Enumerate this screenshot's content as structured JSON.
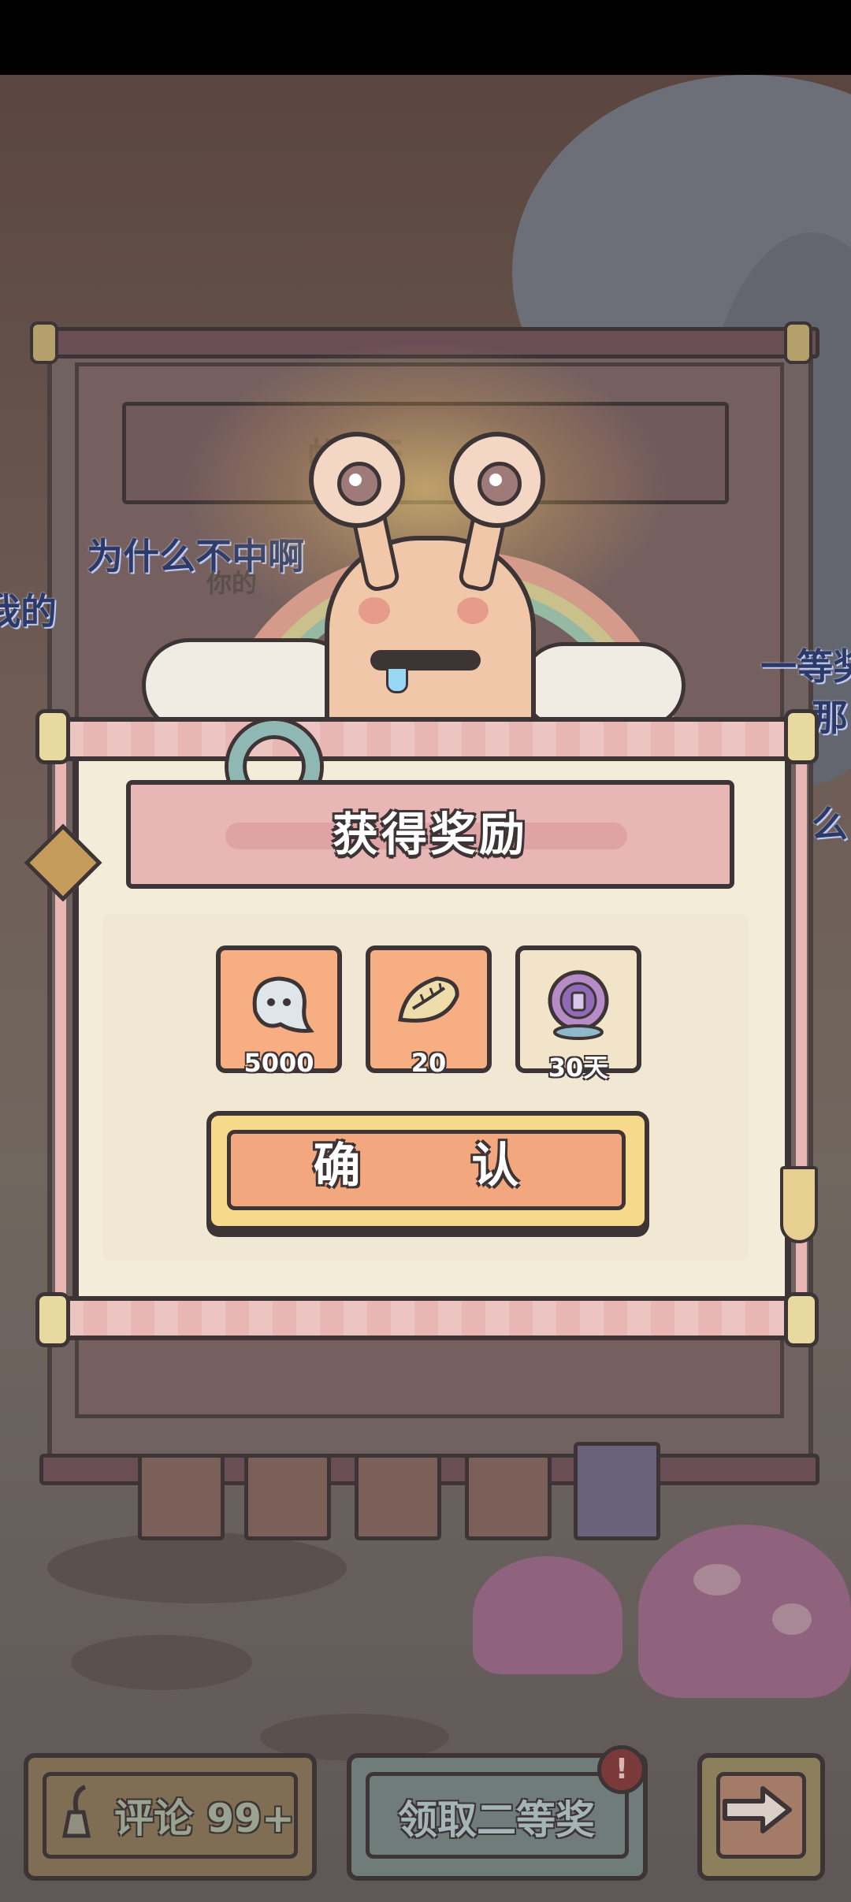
{
  "modal": {
    "title": "获得奖励",
    "rewards": [
      {
        "icon": "ghost-currency-icon",
        "count": "5000"
      },
      {
        "icon": "dumpling-icon",
        "count": "20"
      },
      {
        "icon": "crystal-ball-frame-icon",
        "count": "30天"
      }
    ],
    "confirm_label": "确 认"
  },
  "background": {
    "overlay_texts": [
      "为什么不中啊",
      "我的",
      "一等奖",
      "那",
      "么",
      "你的"
    ],
    "back_title_partial": "蜗 行"
  },
  "bottom_bar": {
    "comment_label": "评论 99+",
    "claim_label": "领取二等奖",
    "claim_badge": "!",
    "next_icon": "arrow-right-icon"
  },
  "colors": {
    "modal_bg": "#f3ecd9",
    "title_plate": "#e9b6b6",
    "reward_tile": "#f6ae82",
    "confirm_button": "#f3a77e",
    "outline": "#3d3436"
  }
}
